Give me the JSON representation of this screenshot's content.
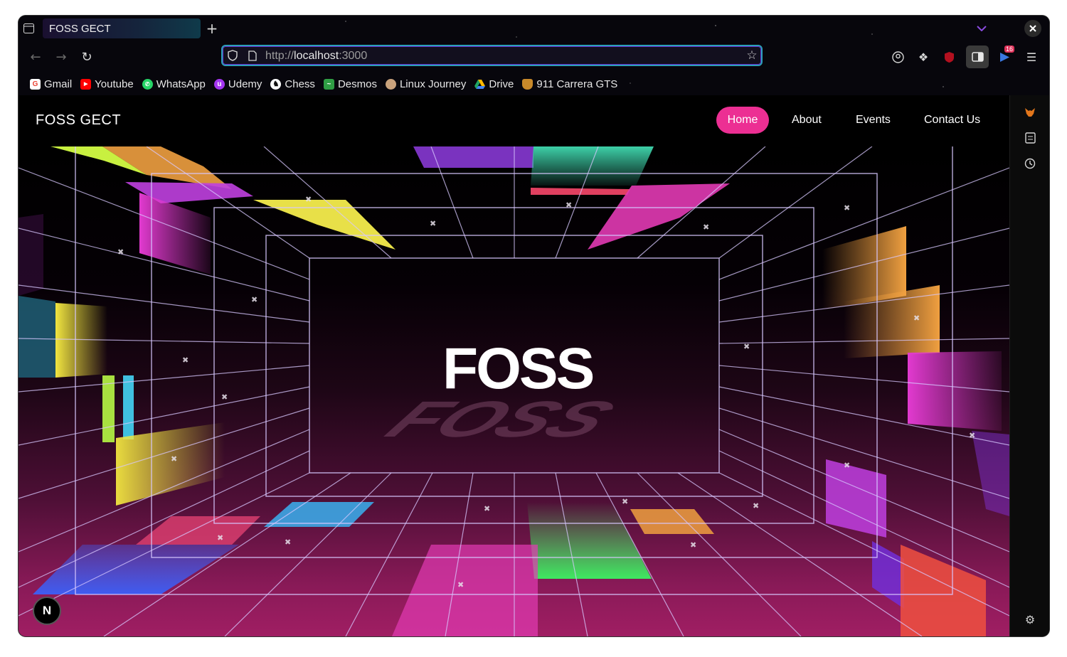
{
  "browser": {
    "tab_title": "FOSS GECT",
    "url_scheme": "http://",
    "url_host": "localhost",
    "url_port": ":3000",
    "extension_badge": "16",
    "bookmarks": [
      {
        "label": "Gmail",
        "icon": "gmail-icon",
        "color": "#ea4335"
      },
      {
        "label": "Youtube",
        "icon": "youtube-icon",
        "color": "#ff0000"
      },
      {
        "label": "WhatsApp",
        "icon": "whatsapp-icon",
        "color": "#25d366"
      },
      {
        "label": "Udemy",
        "icon": "udemy-icon",
        "color": "#a435f0"
      },
      {
        "label": "Chess",
        "icon": "chess-icon",
        "color": "#ffffff"
      },
      {
        "label": "Desmos",
        "icon": "desmos-icon",
        "color": "#2f9e44"
      },
      {
        "label": "Linux Journey",
        "icon": "linux-journey-icon",
        "color": "#c9a27c"
      },
      {
        "label": "Drive",
        "icon": "drive-icon",
        "color": "#1fa463"
      },
      {
        "label": "911 Carrera GTS",
        "icon": "porsche-icon",
        "color": "#c8892a"
      }
    ]
  },
  "site": {
    "brand": "FOSS GECT",
    "nav": [
      {
        "label": "Home",
        "active": true
      },
      {
        "label": "About",
        "active": false
      },
      {
        "label": "Events",
        "active": false
      },
      {
        "label": "Contact Us",
        "active": false
      }
    ],
    "hero_title": "FOSS",
    "hero_title_reflection": "FOSS",
    "dev_badge": "N"
  },
  "colors": {
    "accent": "#ec2f93",
    "grid": "#d8c8ff",
    "url_border": "#2aa0b8"
  }
}
